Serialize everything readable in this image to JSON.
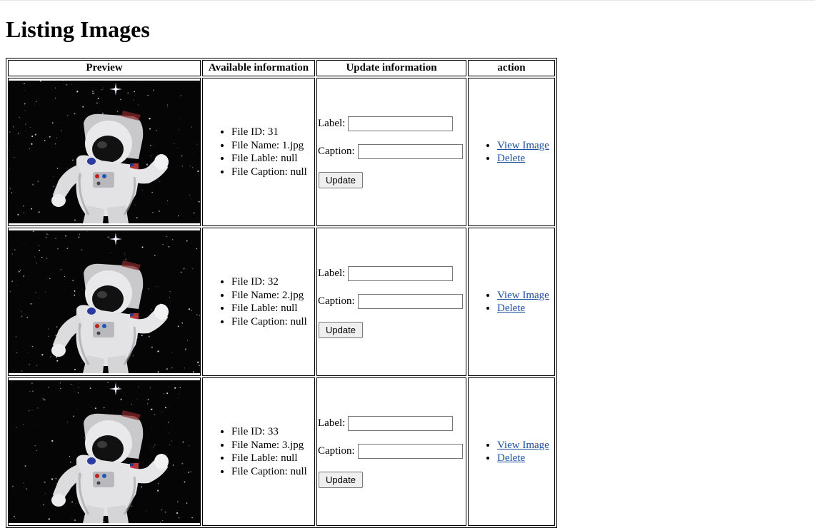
{
  "page": {
    "title": "Listing Images"
  },
  "table": {
    "headers": [
      "Preview",
      "Available information",
      "Update information",
      "action"
    ],
    "rows": [
      {
        "file_id": "File ID: 31",
        "file_name": "File Name: 1.jpg",
        "file_label": "File Lable: null",
        "file_caption": "File Caption: null",
        "label_text": "Label:",
        "caption_text": "Caption:",
        "label_value": "",
        "caption_value": "",
        "update_label": "Update",
        "view_label": "View Image",
        "delete_label": "Delete"
      },
      {
        "file_id": "File ID: 32",
        "file_name": "File Name: 2.jpg",
        "file_label": "File Lable: null",
        "file_caption": "File Caption: null",
        "label_text": "Label:",
        "caption_text": "Caption:",
        "label_value": "",
        "caption_value": "",
        "update_label": "Update",
        "view_label": "View Image",
        "delete_label": "Delete"
      },
      {
        "file_id": "File ID: 33",
        "file_name": "File Name: 3.jpg",
        "file_label": "File Lable: null",
        "file_caption": "File Caption: null",
        "label_text": "Label:",
        "caption_text": "Caption:",
        "label_value": "",
        "caption_value": "",
        "update_label": "Update",
        "view_label": "View Image",
        "delete_label": "Delete"
      }
    ]
  },
  "colors": {
    "link": "#1a4fa0",
    "space": "#050505",
    "suit": "#e8e8ea"
  }
}
